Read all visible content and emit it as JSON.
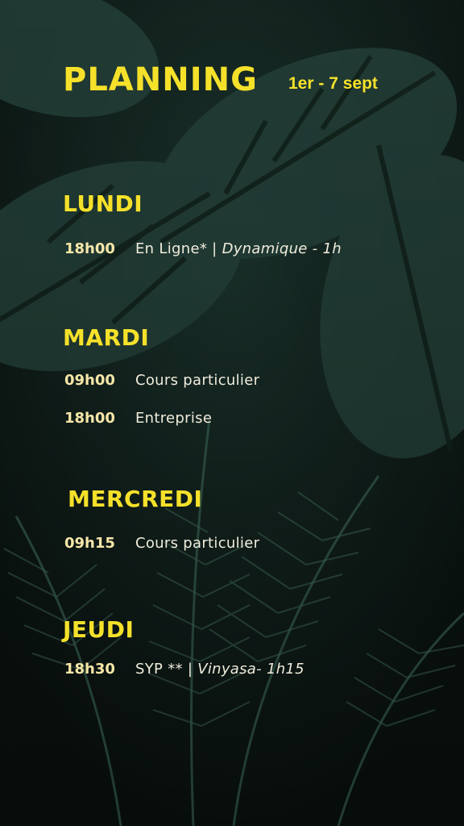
{
  "header": {
    "title": "PLANNING",
    "dates": "1er - 7 sept"
  },
  "days": [
    {
      "name": "LUNDI",
      "entries": [
        {
          "time": "18h00",
          "desc": "En Ligne* | ",
          "style": "Dynamique - 1h"
        }
      ]
    },
    {
      "name": "MARDI",
      "entries": [
        {
          "time": "09h00",
          "desc": "Cours particulier",
          "style": ""
        },
        {
          "time": "18h00",
          "desc": "Entreprise",
          "style": ""
        }
      ]
    },
    {
      "name": "MERCREDI",
      "entries": [
        {
          "time": "09h15",
          "desc": "Cours particulier",
          "style": ""
        }
      ]
    },
    {
      "name": "JEUDI",
      "entries": [
        {
          "time": "18h30",
          "desc": "SYP ** | ",
          "style": "Vinyasa- 1h15"
        }
      ]
    }
  ],
  "colors": {
    "accent": "#f5e12a",
    "background": "#101a16"
  }
}
